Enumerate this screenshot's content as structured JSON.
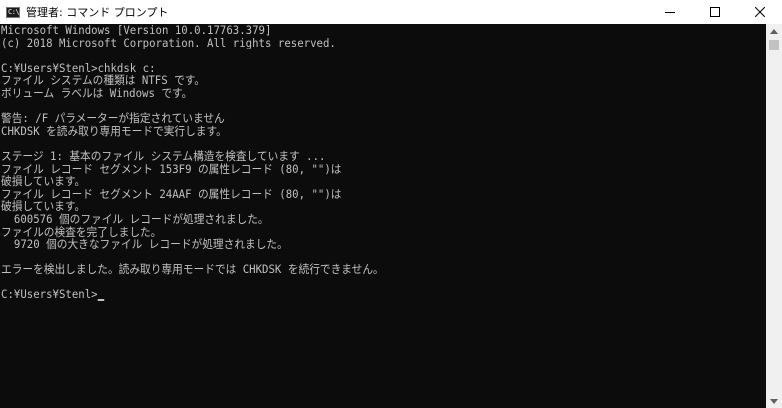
{
  "window": {
    "icon_text": "C:\\",
    "title": "管理者: コマンド プロンプト"
  },
  "controls": {
    "minimize_icon": "minimize-icon",
    "maximize_icon": "maximize-icon",
    "close_icon": "close-icon"
  },
  "colors": {
    "console_bg": "#0c0c0c",
    "console_fg": "#c0c0c0",
    "titlebar_bg": "#ffffff"
  },
  "console": {
    "lines": [
      "Microsoft Windows [Version 10.0.17763.379]",
      "(c) 2018 Microsoft Corporation. All rights reserved.",
      "",
      "C:¥Users¥Stenl>chkdsk c:",
      "ファイル システムの種類は NTFS です。",
      "ボリューム ラベルは Windows です。",
      "",
      "警告: /F パラメーターが指定されていません",
      "CHKDSK を読み取り専用モードで実行します。",
      "",
      "ステージ 1: 基本のファイル システム構造を検査しています ...",
      "ファイル レコード セグメント 153F9 の属性レコード (80, \"\")は",
      "破損しています。",
      "ファイル レコード セグメント 24AAF の属性レコード (80, \"\")は",
      "破損しています。",
      "  600576 個のファイル レコードが処理されました。",
      "ファイルの検査を完了しました。",
      "  9720 個の大きなファイル レコードが処理されました。",
      "",
      "エラーを検出しました。読み取り専用モードでは CHKDSK を続行できません。",
      "",
      "C:¥Users¥Stenl>"
    ]
  }
}
